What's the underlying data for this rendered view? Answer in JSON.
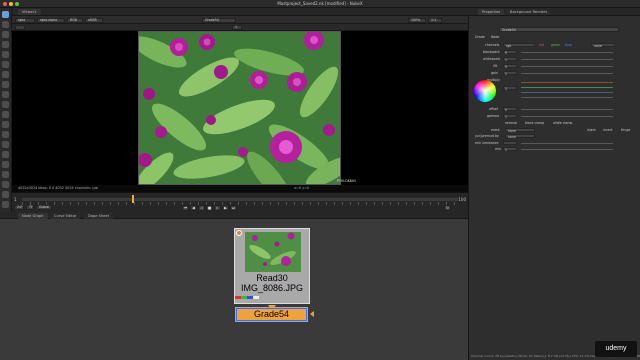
{
  "window": {
    "title": "Mastproject_Saved2.nk [modified] - NukeX"
  },
  "viewer": {
    "tab_label": "Viewer1",
    "channel_set": "rgba",
    "channel_layer": "rgba.alpha",
    "colorspace": "RGB",
    "color_transform": "sRGB",
    "zoom": "100%",
    "frame_ratio": "1:1",
    "node_input": "Grade54",
    "frame": "1",
    "status_left": "4032x3024  bbox: 0 0 4032 3024 channels: rgb",
    "status_right": "x=0 y=0",
    "watermark": "PTKLOKKIN"
  },
  "timeline": {
    "fps": "24*",
    "tc_label": "TF",
    "mode": "Global",
    "end_frame": "100",
    "start_frame": "1"
  },
  "bottom_tabs": [
    "Node Graph",
    "Curve Editor",
    "Dope Sheet"
  ],
  "nodes": {
    "read": {
      "name": "Read30",
      "file": "IMG_8086.JPG"
    },
    "grade": {
      "name": "Grade54"
    }
  },
  "properties": {
    "tab_properties": "Properties",
    "tab_background": "Background Renders",
    "node_name": "Grade54",
    "subtabs": [
      "Grade",
      "Node"
    ],
    "channels_label": "channels",
    "channels_value": "rgb",
    "channel_checks": [
      "red",
      "green",
      "blue"
    ],
    "channel_extra": "none",
    "rows": [
      {
        "label": "blackpoint",
        "value": "0"
      },
      {
        "label": "whitepoint",
        "value": "1"
      },
      {
        "label": "lift",
        "value": "0"
      },
      {
        "label": "gain",
        "value": "1"
      },
      {
        "label": "multiply",
        "value": "1"
      },
      {
        "label": "offset",
        "value": "0"
      },
      {
        "label": "gamma",
        "value": "1"
      }
    ],
    "clamp_options": [
      "reverse",
      "black clamp",
      "white clamp"
    ],
    "mask_label": "mask",
    "mask_value": "none",
    "inject_label": "inject",
    "invert_label": "invert",
    "fringe_label": "fringe",
    "unpremult_label": "(un)premult by",
    "unpremult_value": "none",
    "mix_luminance_label": "mix luminance",
    "mix_label": "mix",
    "mix_value": "1"
  },
  "status_bar": {
    "text": "Channel Count: 28  Localization Mode: On  Memory: 8.7 GB (13.3%)  CPU: 11.0%  Disk: 126.4 MB/s  Network: 0.0 MB/s"
  },
  "watermark": {
    "brand": "udemy"
  },
  "colors": {
    "accent_orange": "#f0a23a",
    "selection_blue": "#3b6fff",
    "node_graph_bg": "#3a3a3a",
    "viewer_bg": "#000000"
  }
}
